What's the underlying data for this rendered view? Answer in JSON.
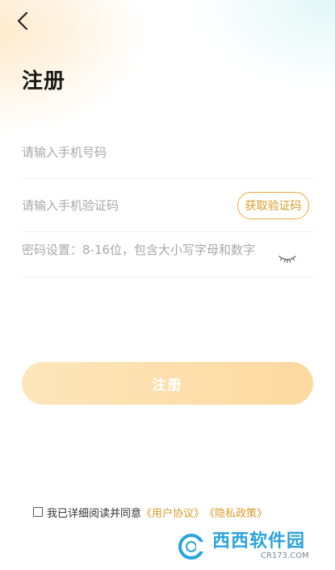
{
  "page": {
    "title": "注册"
  },
  "form": {
    "phone_placeholder": "请输入手机号码",
    "code_placeholder": "请输入手机验证码",
    "get_code_label": "获取验证码",
    "password_placeholder": "密码设置：8-16位，包含大小写字母和数字",
    "submit_label": "注册"
  },
  "agreement": {
    "prefix": "我已详细阅读并同意",
    "user_agreement": "《用户协议》",
    "privacy_policy": "《隐私政策》",
    "checked": false
  },
  "watermark": {
    "main": "西西软件园",
    "sub": "CR173.COM"
  },
  "colors": {
    "accent": "#d99a28",
    "button_start": "#fde6bb",
    "button_end": "#fdd9a0",
    "watermark": "#2aa3de"
  },
  "icons": {
    "back": "chevron-left-icon",
    "password_toggle": "eye-closed-icon"
  }
}
